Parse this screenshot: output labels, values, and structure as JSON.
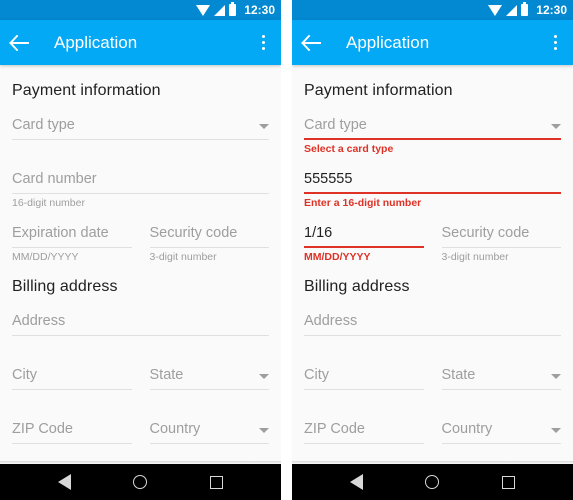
{
  "status_bar": {
    "time": "12:30",
    "icons": [
      "wifi-icon",
      "signal-icon",
      "battery-icon"
    ],
    "background": "#0289d1"
  },
  "app_bar": {
    "title": "Application",
    "back_icon": "back-arrow-icon",
    "overflow_icon": "more-vert-icon",
    "background": "#03a9f4"
  },
  "nav_bar": {
    "back_label": "Back",
    "home_label": "Home",
    "recents_label": "Recents"
  },
  "colors": {
    "accent": "#03a9f4",
    "status": "#0289d1",
    "error": "#de3226",
    "hint": "#9e9e9e",
    "text": "#212121",
    "background": "#fafafa",
    "underline": "#e0e0e0"
  },
  "panels": [
    {
      "id": "valid-state",
      "sections": [
        {
          "title": "Payment information",
          "rows": [
            {
              "fields": [
                {
                  "name": "card-type",
                  "text": "Card type",
                  "filled": false,
                  "dropdown": true,
                  "helper": "",
                  "error": false
                }
              ]
            },
            {
              "fields": [
                {
                  "name": "card-number",
                  "text": "Card number",
                  "filled": false,
                  "dropdown": false,
                  "helper": "16-digit number",
                  "error": false
                }
              ]
            },
            {
              "fields": [
                {
                  "name": "expiration-date",
                  "text": "Expiration date",
                  "filled": false,
                  "dropdown": false,
                  "helper": "MM/DD/YYYY",
                  "error": false
                },
                {
                  "name": "security-code",
                  "text": "Security code",
                  "filled": false,
                  "dropdown": false,
                  "helper": "3-digit number",
                  "error": false
                }
              ]
            }
          ]
        },
        {
          "title": "Billing address",
          "rows": [
            {
              "fields": [
                {
                  "name": "address",
                  "text": "Address",
                  "filled": false,
                  "dropdown": false,
                  "helper": "",
                  "error": false
                }
              ]
            },
            {
              "fields": [
                {
                  "name": "city",
                  "text": "City",
                  "filled": false,
                  "dropdown": false,
                  "helper": "",
                  "error": false
                },
                {
                  "name": "state",
                  "text": "State",
                  "filled": false,
                  "dropdown": true,
                  "helper": "",
                  "error": false
                }
              ]
            },
            {
              "fields": [
                {
                  "name": "zip-code",
                  "text": "ZIP Code",
                  "filled": false,
                  "dropdown": false,
                  "helper": "",
                  "error": false
                },
                {
                  "name": "country",
                  "text": "Country",
                  "filled": false,
                  "dropdown": true,
                  "helper": "",
                  "error": false
                }
              ]
            }
          ]
        }
      ]
    },
    {
      "id": "error-state",
      "sections": [
        {
          "title": "Payment information",
          "rows": [
            {
              "fields": [
                {
                  "name": "card-type",
                  "text": "Card type",
                  "filled": false,
                  "dropdown": true,
                  "helper": "Select a card type",
                  "error": true
                }
              ]
            },
            {
              "fields": [
                {
                  "name": "card-number",
                  "text": "555555",
                  "filled": true,
                  "dropdown": false,
                  "helper": "Enter a 16-digit number",
                  "error": true
                }
              ]
            },
            {
              "fields": [
                {
                  "name": "expiration-date",
                  "text": "1/16",
                  "filled": true,
                  "dropdown": false,
                  "helper": "MM/DD/YYYY",
                  "error": true
                },
                {
                  "name": "security-code",
                  "text": "Security code",
                  "filled": false,
                  "dropdown": false,
                  "helper": "3-digit number",
                  "error": false
                }
              ]
            }
          ]
        },
        {
          "title": "Billing address",
          "rows": [
            {
              "fields": [
                {
                  "name": "address",
                  "text": "Address",
                  "filled": false,
                  "dropdown": false,
                  "helper": "",
                  "error": false
                }
              ]
            },
            {
              "fields": [
                {
                  "name": "city",
                  "text": "City",
                  "filled": false,
                  "dropdown": false,
                  "helper": "",
                  "error": false
                },
                {
                  "name": "state",
                  "text": "State",
                  "filled": false,
                  "dropdown": true,
                  "helper": "",
                  "error": false
                }
              ]
            },
            {
              "fields": [
                {
                  "name": "zip-code",
                  "text": "ZIP Code",
                  "filled": false,
                  "dropdown": false,
                  "helper": "",
                  "error": false
                },
                {
                  "name": "country",
                  "text": "Country",
                  "filled": false,
                  "dropdown": true,
                  "helper": "",
                  "error": false
                }
              ]
            }
          ]
        }
      ]
    }
  ]
}
